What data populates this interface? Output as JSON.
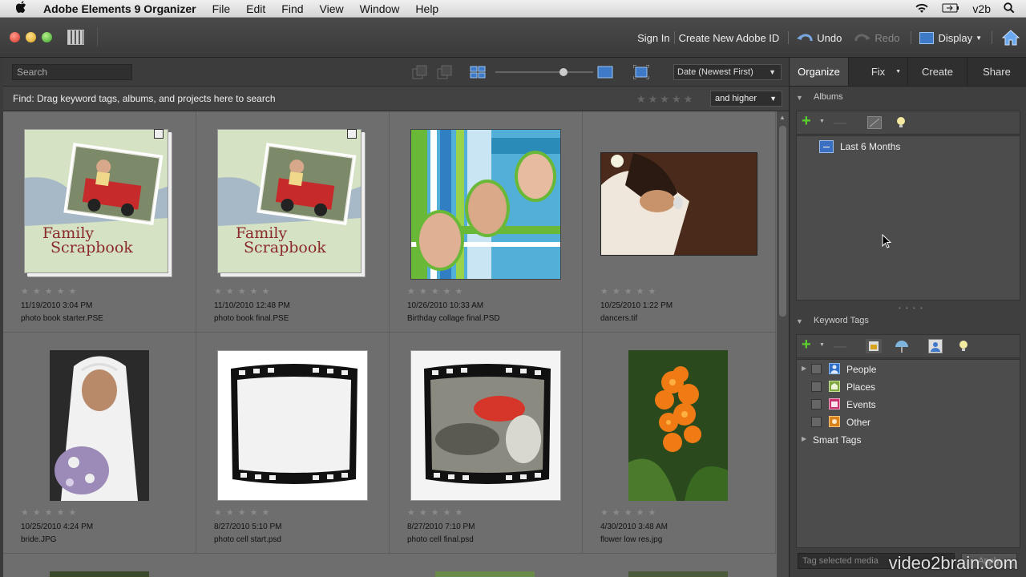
{
  "menubar": {
    "app_name": "Adobe Elements 9 Organizer",
    "items": [
      "File",
      "Edit",
      "Find",
      "View",
      "Window",
      "Help"
    ],
    "user": "v2b"
  },
  "toolbar": {
    "sign_in": "Sign In",
    "create_id": "Create New Adobe ID",
    "undo": "Undo",
    "redo": "Redo",
    "display": "Display"
  },
  "search": {
    "placeholder": "Search"
  },
  "sort": {
    "selected": "Date (Newest First)"
  },
  "find": {
    "text": "Find: Drag keyword tags, albums, and projects here to search",
    "rating_filter": "and higher"
  },
  "media": [
    {
      "date": "11/19/2010 3:04 PM",
      "name": "photo book starter.PSE",
      "thumb": "scrapbook",
      "caption": "Family Scrapbook"
    },
    {
      "date": "11/10/2010 12:48 PM",
      "name": "photo book final.PSE",
      "thumb": "scrapbook",
      "caption": "Family Scrapbook"
    },
    {
      "date": "10/26/2010 10:33 AM",
      "name": "Birthday collage final.PSD",
      "thumb": "collage"
    },
    {
      "date": "10/25/2010 1:22 PM",
      "name": "dancers.tif",
      "thumb": "dancers"
    },
    {
      "date": "10/25/2010 4:24 PM",
      "name": "bride.JPG",
      "thumb": "bride"
    },
    {
      "date": "8/27/2010 5:10 PM",
      "name": "photo cell start.psd",
      "thumb": "film-empty"
    },
    {
      "date": "8/27/2010 7:10 PM",
      "name": "photo cell final.psd",
      "thumb": "film-fish"
    },
    {
      "date": "4/30/2010 3:48 AM",
      "name": "flower low res.jpg",
      "thumb": "flower"
    }
  ],
  "panel": {
    "tabs": [
      "Organize",
      "Fix",
      "Create",
      "Share"
    ],
    "albums_title": "Albums",
    "albums": [
      "Last 6 Months"
    ],
    "keywords_title": "Keyword Tags",
    "keywords": [
      "People",
      "Places",
      "Events",
      "Other"
    ],
    "smart_tags": "Smart Tags",
    "tag_placeholder": "Tag selected media",
    "apply": "Apply"
  },
  "watermark": "video2brain.com",
  "colors": {
    "accent_green": "#5bd22c",
    "album_blue": "#3a6fc2",
    "background": "#3b3b3b",
    "grid_bg": "#6e6e6e"
  }
}
